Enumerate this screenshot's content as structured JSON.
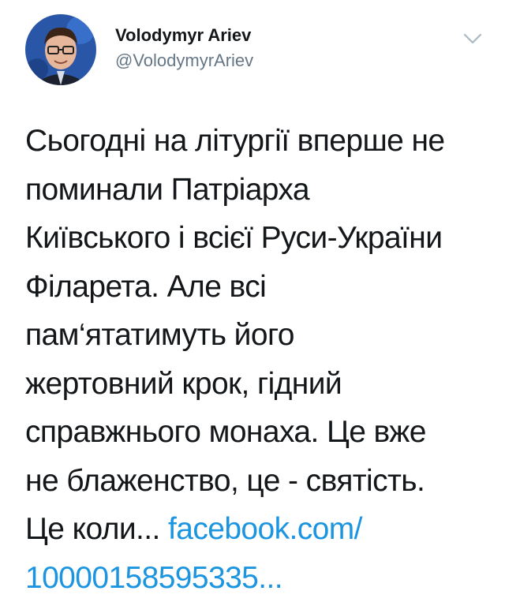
{
  "author": {
    "display_name": "Volodymyr Ariev",
    "handle": "@VolodymyrAriev",
    "avatar_icon": "profile-photo"
  },
  "menu": {
    "icon": "chevron-down-icon"
  },
  "tweet": {
    "lines": [
      "Сьогодні на літургії вперше не",
      "поминали Патріарха",
      "Київського і всієї Руси-України",
      "Філарета. Але всі",
      "пам‘ятатимуть його",
      "жертовний крок, гідний",
      "справжнього монаха. Це вже",
      "не блаженство, це - святість."
    ],
    "last_line_text": "Це коли... ",
    "link_part1": "facebook.com/",
    "link_part2": "10000158595335..."
  },
  "colors": {
    "text": "#14171a",
    "secondary": "#657786",
    "link": "#1b95e0"
  }
}
